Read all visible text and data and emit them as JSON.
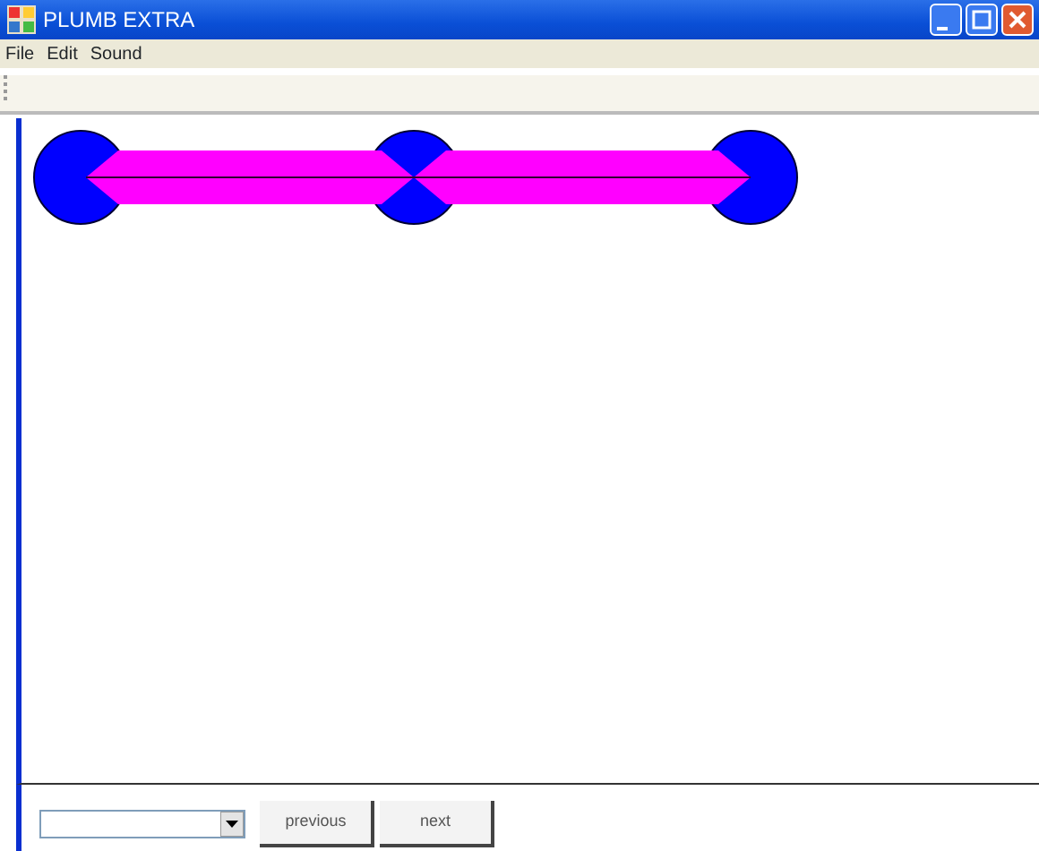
{
  "window": {
    "title": "PLUMB EXTRA"
  },
  "menu": [
    {
      "label": "File"
    },
    {
      "label": "Edit"
    },
    {
      "label": "Sound"
    }
  ],
  "buttons": [
    {
      "label": "previous"
    },
    {
      "label": "next"
    }
  ]
}
